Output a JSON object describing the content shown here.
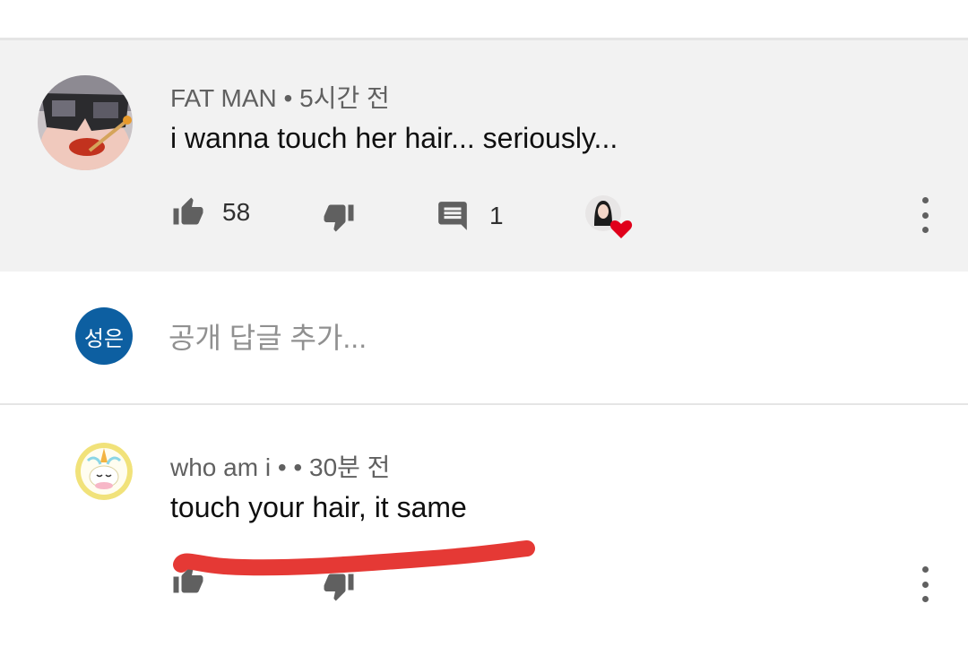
{
  "comment1": {
    "author": "FAT MAN",
    "time": "5시간 전",
    "text": "i wanna touch her hair... seriously...",
    "likes": "58",
    "replies": "1"
  },
  "reply_box": {
    "avatar_text": "성은",
    "placeholder": "공개 답글 추가..."
  },
  "comment2": {
    "author": "who am i",
    "time": "30분 전",
    "text": "touch your hair, it same"
  },
  "colors": {
    "highlight_bg": "#f2f2f2",
    "separator": "#e5e5e5",
    "reply_avatar_bg": "#0d5fa1",
    "heart": "#e0001b",
    "redaction_stroke": "#e53935"
  },
  "icons": [
    "thumb-up-icon",
    "thumb-down-icon",
    "reply-icon",
    "creator-heart-icon",
    "more-vert-icon"
  ]
}
